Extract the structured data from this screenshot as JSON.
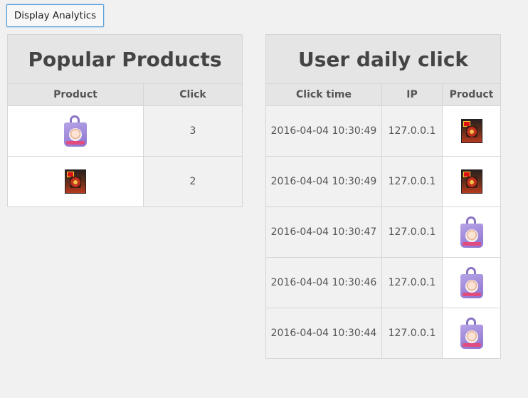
{
  "toolbar": {
    "display_analytics_label": "Display Analytics"
  },
  "popular": {
    "title": "Popular Products",
    "columns": [
      "Product",
      "Click"
    ],
    "rows": [
      {
        "product_icon": "purple-bag-icon",
        "clicks": "3"
      },
      {
        "product_icon": "toy-box-icon",
        "clicks": "2"
      }
    ]
  },
  "daily": {
    "title": "User daily click",
    "columns": [
      "Click time",
      "IP",
      "Product"
    ],
    "rows": [
      {
        "time": "2016-04-04 10:30:49",
        "ip": "127.0.0.1",
        "product_icon": "toy-box-icon"
      },
      {
        "time": "2016-04-04 10:30:49",
        "ip": "127.0.0.1",
        "product_icon": "toy-box-icon"
      },
      {
        "time": "2016-04-04 10:30:47",
        "ip": "127.0.0.1",
        "product_icon": "purple-bag-icon"
      },
      {
        "time": "2016-04-04 10:30:46",
        "ip": "127.0.0.1",
        "product_icon": "purple-bag-icon"
      },
      {
        "time": "2016-04-04 10:30:44",
        "ip": "127.0.0.1",
        "product_icon": "purple-bag-icon"
      }
    ]
  },
  "colors": {
    "background": "#f1f1f1",
    "header": "#e5e5e5",
    "button_border": "#5b9dd9"
  }
}
